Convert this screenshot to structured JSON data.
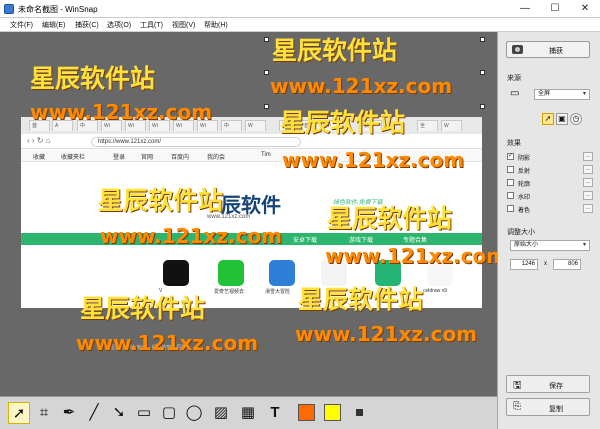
{
  "window": {
    "title": "未命名截图 - WinSnap",
    "controls": {
      "minimize": "—",
      "maximize": "☐",
      "close": "✕"
    }
  },
  "menu": [
    "文件(F)",
    "编辑(E)",
    "捕获(C)",
    "选项(O)",
    "工具(T)",
    "视图(V)",
    "帮助(H)"
  ],
  "browser": {
    "tabs": [
      "首",
      "A",
      "中",
      "Wi",
      "Wi",
      "Wi",
      "Wi",
      "Wi",
      "中",
      "W",
      "百",
      "首",
      "中",
      "软",
      "全",
      "W"
    ],
    "url": "https://www.121xz.com/",
    "bookmarks": [
      "收藏",
      "收藏夹栏",
      "登录",
      "官网",
      "百度内",
      "我的会",
      "Tim"
    ],
    "site_logo": "辰软件",
    "site_logo_sub": "www.121xz.com",
    "slogan": "绿色软件,免费下载",
    "nav": [
      "安卓下载",
      "游戏下载",
      "专题合集"
    ],
    "apps": [
      {
        "label": "V",
        "color": "#111111"
      },
      {
        "label": "爱奇艺视频去",
        "color": "#21c236"
      },
      {
        "label": "滑雪大冒险",
        "color": "#2f7fd9"
      },
      {
        "label": "",
        "color": "#f3f3f3"
      },
      {
        "label": "",
        "color": "#22b573"
      },
      {
        "label": "celdraw x9",
        "color": "#f7f7f7"
      }
    ],
    "below_text": "星辰软件站-安全、绿色的软件园区"
  },
  "watermarks": {
    "cn": "星辰软件站",
    "url": "www.121xz.com"
  },
  "panel": {
    "capture_label": "捕获",
    "source_title": "来源",
    "source_value": "全屏",
    "effects_title": "效果",
    "effects": [
      {
        "label": "阴影",
        "checked": true
      },
      {
        "label": "反射",
        "checked": false
      },
      {
        "label": "轮廓",
        "checked": false
      },
      {
        "label": "水印",
        "checked": false
      },
      {
        "label": "着色",
        "checked": false
      }
    ],
    "resize_title": "调整大小",
    "resize_value": "原始大小",
    "width": "1246",
    "times": "x",
    "height": "806",
    "save_label": "保存",
    "copy_label": "复制"
  },
  "tools": [
    {
      "name": "select-tool",
      "glyph": "➚"
    },
    {
      "name": "crop-tool",
      "glyph": "⌗"
    },
    {
      "name": "pen-tool",
      "glyph": "✒"
    },
    {
      "name": "line-tool",
      "glyph": "╱"
    },
    {
      "name": "arrow-tool",
      "glyph": "➘"
    },
    {
      "name": "rectangle-tool",
      "glyph": "▭"
    },
    {
      "name": "rounded-rect-tool",
      "glyph": "▢"
    },
    {
      "name": "ellipse-tool",
      "glyph": "◯"
    },
    {
      "name": "hatch-tool",
      "glyph": "▨"
    },
    {
      "name": "pixelate-tool",
      "glyph": "▦"
    },
    {
      "name": "text-tool",
      "glyph": "T"
    }
  ],
  "colors": {
    "primary": "#ff6a00",
    "secondary": "#ffff00",
    "accent_green": "#2cb56e"
  }
}
